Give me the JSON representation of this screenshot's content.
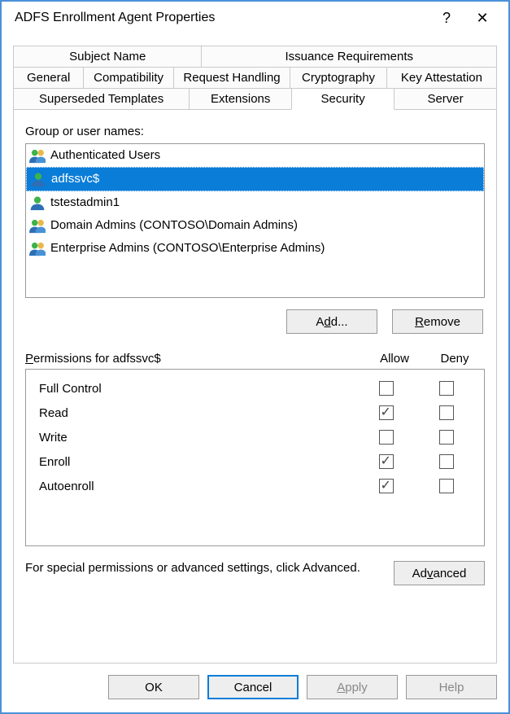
{
  "title": "ADFS Enrollment Agent Properties",
  "titlebar": {
    "help": "?",
    "close": "✕"
  },
  "tabs": {
    "row1": [
      {
        "label": "Subject Name",
        "name": "tab-subject-name"
      },
      {
        "label": "Issuance Requirements",
        "name": "tab-issuance-requirements"
      }
    ],
    "row2": [
      {
        "label": "General",
        "name": "tab-general"
      },
      {
        "label": "Compatibility",
        "name": "tab-compatibility"
      },
      {
        "label": "Request Handling",
        "name": "tab-request-handling"
      },
      {
        "label": "Cryptography",
        "name": "tab-cryptography"
      },
      {
        "label": "Key Attestation",
        "name": "tab-key-attestation"
      }
    ],
    "row3": [
      {
        "label": "Superseded Templates",
        "name": "tab-superseded-templates"
      },
      {
        "label": "Extensions",
        "name": "tab-extensions"
      },
      {
        "label": "Security",
        "name": "tab-security",
        "active": true
      },
      {
        "label": "Server",
        "name": "tab-server"
      }
    ]
  },
  "security": {
    "group_label": "Group or user names:",
    "items": [
      {
        "text": "Authenticated Users",
        "icon": "group",
        "selected": false
      },
      {
        "text": "adfssvc$",
        "icon": "user",
        "selected": true
      },
      {
        "text": "tstestadmin1",
        "icon": "user",
        "selected": false
      },
      {
        "text": "Domain Admins (CONTOSO\\Domain Admins)",
        "icon": "group",
        "selected": false
      },
      {
        "text": "Enterprise Admins (CONTOSO\\Enterprise Admins)",
        "icon": "group",
        "selected": false
      }
    ],
    "add_label": "Add...",
    "remove_label": "Remove",
    "perm_label": "Permissions for adfssvc$",
    "allow_label": "Allow",
    "deny_label": "Deny",
    "permissions": [
      {
        "name": "Full Control",
        "allow": false,
        "deny": false
      },
      {
        "name": "Read",
        "allow": true,
        "deny": false
      },
      {
        "name": "Write",
        "allow": false,
        "deny": false
      },
      {
        "name": "Enroll",
        "allow": true,
        "deny": false
      },
      {
        "name": "Autoenroll",
        "allow": true,
        "deny": false
      }
    ],
    "advanced_text": "For special permissions or advanced settings, click Advanced.",
    "advanced_button": "Advanced"
  },
  "buttons": {
    "ok": "OK",
    "cancel": "Cancel",
    "apply": "Apply",
    "help": "Help"
  }
}
